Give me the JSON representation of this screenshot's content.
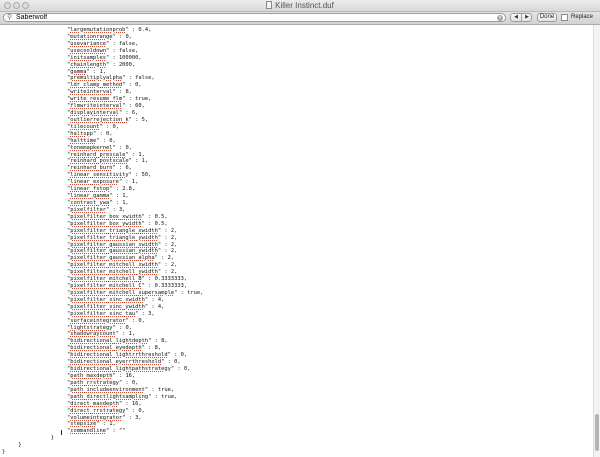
{
  "window": {
    "title": "Killer Instinct.duf"
  },
  "find_bar": {
    "search_value": "Saberwolf",
    "prev_icon": "chevron-left-icon",
    "next_icon": "chevron-right-icon",
    "done_label": "Done",
    "replace_label": "Replace",
    "replace_checked": false
  },
  "editor": {
    "lines": [
      {
        "indent": 20,
        "key": "largemutationprob",
        "rest": " : 0.4,"
      },
      {
        "indent": 20,
        "key": "mutationrange",
        "rest": " : 0,"
      },
      {
        "indent": 20,
        "key": "usevariance",
        "rest": " : false,"
      },
      {
        "indent": 20,
        "key": "usecooldown",
        "rest": " : false,"
      },
      {
        "indent": 20,
        "key": "initsamples",
        "rest": " : 100000,"
      },
      {
        "indent": 20,
        "key": "chainlength",
        "rest": " : 2000,"
      },
      {
        "indent": 20,
        "key": "gamma",
        "rest": " : 1,"
      },
      {
        "indent": 20,
        "key": "premultiplyalpha",
        "rest": " : false,"
      },
      {
        "indent": 20,
        "key": "ldr_clamp_method",
        "rest": " : 0,"
      },
      {
        "indent": 20,
        "key": "writeinterval",
        "rest": " : 8,"
      },
      {
        "indent": 20,
        "key": "write_resume_flm",
        "rest": " : true,"
      },
      {
        "indent": 20,
        "key": "flmwriteinterval",
        "rest": " : 60,"
      },
      {
        "indent": 20,
        "key": "displayinterval",
        "rest": " : 6,"
      },
      {
        "indent": 20,
        "key": "outlierrejection_k",
        "rest": " : 5,"
      },
      {
        "indent": 20,
        "key": "tilecount",
        "rest": " : 0,"
      },
      {
        "indent": 20,
        "key": "haltspp",
        "rest": " : 0,"
      },
      {
        "indent": 20,
        "key": "halttime",
        "rest": " : 0,"
      },
      {
        "indent": 20,
        "key": "tonemapkernel",
        "rest": " : 0,"
      },
      {
        "indent": 20,
        "key": "reinhard_prescale",
        "rest": " : 1,"
      },
      {
        "indent": 20,
        "key": "reinhard_postscale",
        "rest": " : 1,"
      },
      {
        "indent": 20,
        "key": "reinhard_burn",
        "rest": " : 6,"
      },
      {
        "indent": 20,
        "key": "linear_sensitivity",
        "rest": " : 50,"
      },
      {
        "indent": 20,
        "key": "linear_exposure",
        "rest": " : 1,"
      },
      {
        "indent": 20,
        "key": "linear_fstop",
        "rest": " : 2.8,"
      },
      {
        "indent": 20,
        "key": "linear_gamma",
        "rest": " : 1,"
      },
      {
        "indent": 20,
        "key": "contrast_ywa",
        "rest": " : 1,"
      },
      {
        "indent": 20,
        "key": "pixelfilter",
        "rest": " : 3,"
      },
      {
        "indent": 20,
        "key": "pixelfilter_box_xwidth",
        "rest": " : 0.5,"
      },
      {
        "indent": 20,
        "key": "pixelfilter_box_ywidth",
        "rest": " : 0.5,"
      },
      {
        "indent": 20,
        "key": "pixelfilter_triangle_xwidth",
        "rest": " : 2,"
      },
      {
        "indent": 20,
        "key": "pixelfilter_triangle_ywidth",
        "rest": " : 2,"
      },
      {
        "indent": 20,
        "key": "pixelfilter_gaussian_xwidth",
        "rest": " : 2,"
      },
      {
        "indent": 20,
        "key": "pixelfilter_gaussian_ywidth",
        "rest": " : 2,"
      },
      {
        "indent": 20,
        "key": "pixelfilter_gaussian_alpha",
        "rest": " : 2,"
      },
      {
        "indent": 20,
        "key": "pixelfilter_mitchell_xwidth",
        "rest": " : 2,"
      },
      {
        "indent": 20,
        "key": "pixelfilter_mitchell_ywidth",
        "rest": " : 2,"
      },
      {
        "indent": 20,
        "key": "pixelfilter_mitchell_B",
        "rest": " : 0.3333333,"
      },
      {
        "indent": 20,
        "key": "pixelfilter_mitchell_C",
        "rest": " : 0.3333333,"
      },
      {
        "indent": 20,
        "key": "pixelfilter_mitchell_supersample",
        "rest": " : true,"
      },
      {
        "indent": 20,
        "key": "pixelfilter_sinc_xwidth",
        "rest": " : 4,"
      },
      {
        "indent": 20,
        "key": "pixelfilter_sinc_ywidth",
        "rest": " : 4,"
      },
      {
        "indent": 20,
        "key": "pixelfilter_sinc_tau",
        "rest": " : 3,"
      },
      {
        "indent": 20,
        "key": "surfaceintegrator",
        "rest": " : 0,"
      },
      {
        "indent": 20,
        "key": "lightstrategy",
        "rest": " : 0,"
      },
      {
        "indent": 20,
        "key": "shadowraycount",
        "rest": " : 1,"
      },
      {
        "indent": 20,
        "key": "bidirectional_lightdepth",
        "rest": " : 8,"
      },
      {
        "indent": 20,
        "key": "bidirectional_eyedepth",
        "rest": " : 8,"
      },
      {
        "indent": 20,
        "key": "bidirectional_lightrrthreshold",
        "rest": " : 0,"
      },
      {
        "indent": 20,
        "key": "bidirectional_eyerrthreshold",
        "rest": " : 0,"
      },
      {
        "indent": 20,
        "key": "bidirectional_lightpathstrategy",
        "rest": " : 0,"
      },
      {
        "indent": 20,
        "key": "path_maxdepth",
        "rest": " : 16,"
      },
      {
        "indent": 20,
        "key": "path_rrstrategy",
        "rest": " : 0,"
      },
      {
        "indent": 20,
        "key": "path_includeenvironment",
        "rest": " : true,"
      },
      {
        "indent": 20,
        "key": "path_directlightsampling",
        "rest": " : true,"
      },
      {
        "indent": 20,
        "key": "direct_maxdepth",
        "rest": " : 16,"
      },
      {
        "indent": 20,
        "key": "direct_rrstrategy",
        "rest": " : 0,"
      },
      {
        "indent": 20,
        "key": "volumeintegrator",
        "rest": " : 3,"
      },
      {
        "indent": 20,
        "key": "stepsize",
        "rest": " : 1,"
      },
      {
        "indent": 20,
        "key": "commandline",
        "rest": " : \"\""
      },
      {
        "indent": 15,
        "key": "",
        "rest": "}"
      },
      {
        "indent": 5,
        "key": "",
        "rest": "}"
      },
      {
        "indent": 0,
        "key": "",
        "rest": "}"
      }
    ]
  },
  "scrollbar": {
    "thumb_start": 0.9,
    "thumb_end": 0.985
  }
}
